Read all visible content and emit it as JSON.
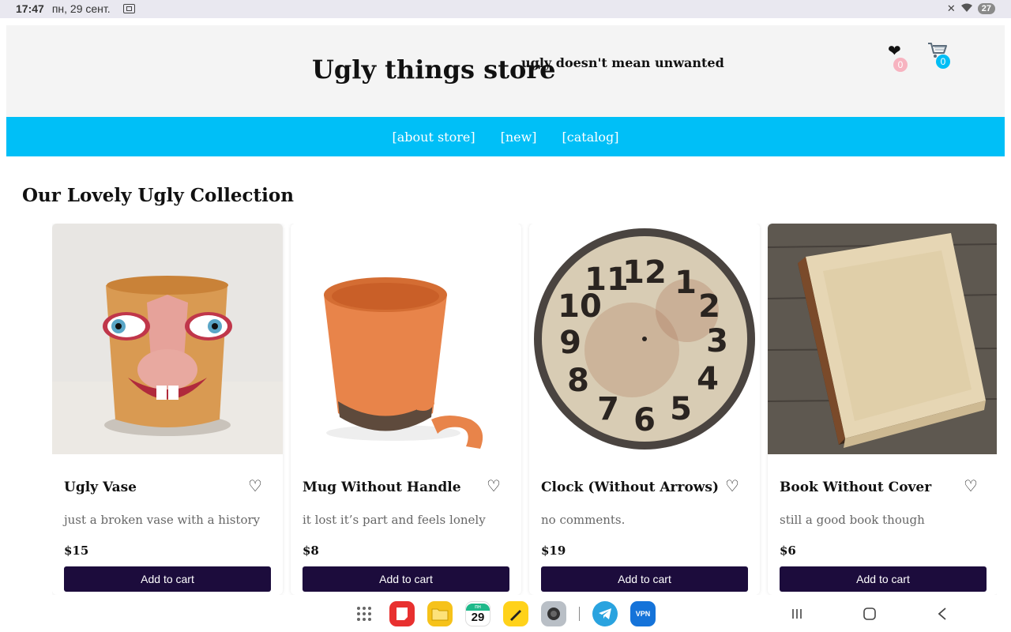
{
  "status_bar": {
    "time": "17:47",
    "date": "пн, 29 сент.",
    "battery": "27",
    "icons": [
      "screenshot-icon",
      "mute-icon",
      "wifi-icon",
      "battery-icon"
    ]
  },
  "store": {
    "title": "Ugly things store",
    "tagline": "ugly doesn't mean unwanted",
    "favorites_count": "0",
    "cart_count": "0",
    "favorites_icon": "heart-icon",
    "cart_icon": "cart-icon",
    "colors": {
      "accent": "#00bff7",
      "button": "#1c0c3c",
      "fav_badge": "#f7b3c0",
      "cart_badge": "#00bef5"
    }
  },
  "nav": {
    "items": [
      {
        "label": "[about store]"
      },
      {
        "label": "[new]"
      },
      {
        "label": "[catalog]"
      }
    ]
  },
  "collection": {
    "title": "Our Lovely Ugly Collection",
    "products": [
      {
        "name": "Ugly Vase",
        "description": "just a broken vase with a history",
        "price": "$15",
        "button": "Add to cart",
        "image": "ugly-face-vase-image"
      },
      {
        "name": "Mug Without Handle",
        "description": "it lost it’s part and feels lonely",
        "price": "$8",
        "button": "Add to cart",
        "image": "broken-mug-image"
      },
      {
        "name": "Clock (Without Arrows)",
        "description": "no comments.",
        "price": "$19",
        "button": "Add to cart",
        "image": "clock-face-image"
      },
      {
        "name": "Book Without Cover",
        "description": "still a good book though",
        "price": "$6",
        "button": "Add to cart",
        "image": "old-book-image"
      }
    ]
  },
  "taskbar": {
    "calendar_day": "29",
    "calendar_weekday": "пн",
    "vpn_label": "VPN",
    "apps": [
      "app-drawer-icon",
      "notes-app-icon",
      "files-app-icon",
      "calendar-app-icon",
      "pen-app-icon",
      "camera-app-icon",
      "telegram-app-icon",
      "vpn-app-icon"
    ],
    "nav": [
      "recents-icon",
      "home-icon",
      "back-icon"
    ]
  }
}
